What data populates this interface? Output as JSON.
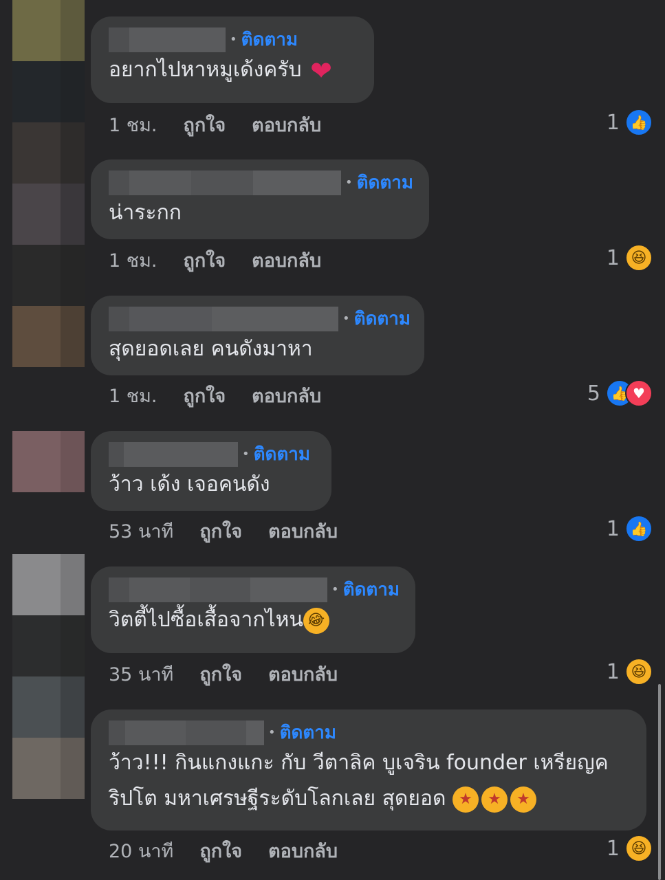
{
  "follow_label": "ติดตาม",
  "like_label": "ถูกใจ",
  "reply_label": "ตอบกลับ",
  "comments": [
    {
      "text": "อยากไปหาหมูเด้งครับ",
      "time": "1 ชม.",
      "reaction_count": "1",
      "reactions": [
        "like-icon"
      ],
      "trailing_emoji": "heart-emoji"
    },
    {
      "text": "น่าระกก",
      "time": "1 ชม.",
      "reaction_count": "1",
      "reactions": [
        "haha-icon"
      ]
    },
    {
      "text": "สุดยอดเลย คนดังมาหา",
      "time": "1 ชม.",
      "reaction_count": "5",
      "reactions": [
        "like-icon",
        "love-icon"
      ]
    },
    {
      "text": "ว้าว เด้ง เจอคนดัง",
      "time": "53 นาที",
      "reaction_count": "1",
      "reactions": [
        "like-icon"
      ]
    },
    {
      "text": "วิตตี้ไปซื้อเสื้อจากไหน",
      "time": "35 นาที",
      "reaction_count": "1",
      "reactions": [
        "haha-icon"
      ],
      "trailing_emoji": "rofl-emoji"
    },
    {
      "text_line1": "ว้าว!!! กินแกงแกะ กับ วีตาลิค บูเจริน founder เหรียญค",
      "text_line2": "ริปโต มหาเศรษฐีระดับโลกเลย สุดยอด",
      "time": "20 นาที",
      "reaction_count": "1",
      "reactions": [
        "haha-icon"
      ],
      "trailing_emoji": "star-struck-emoji x3"
    }
  ]
}
